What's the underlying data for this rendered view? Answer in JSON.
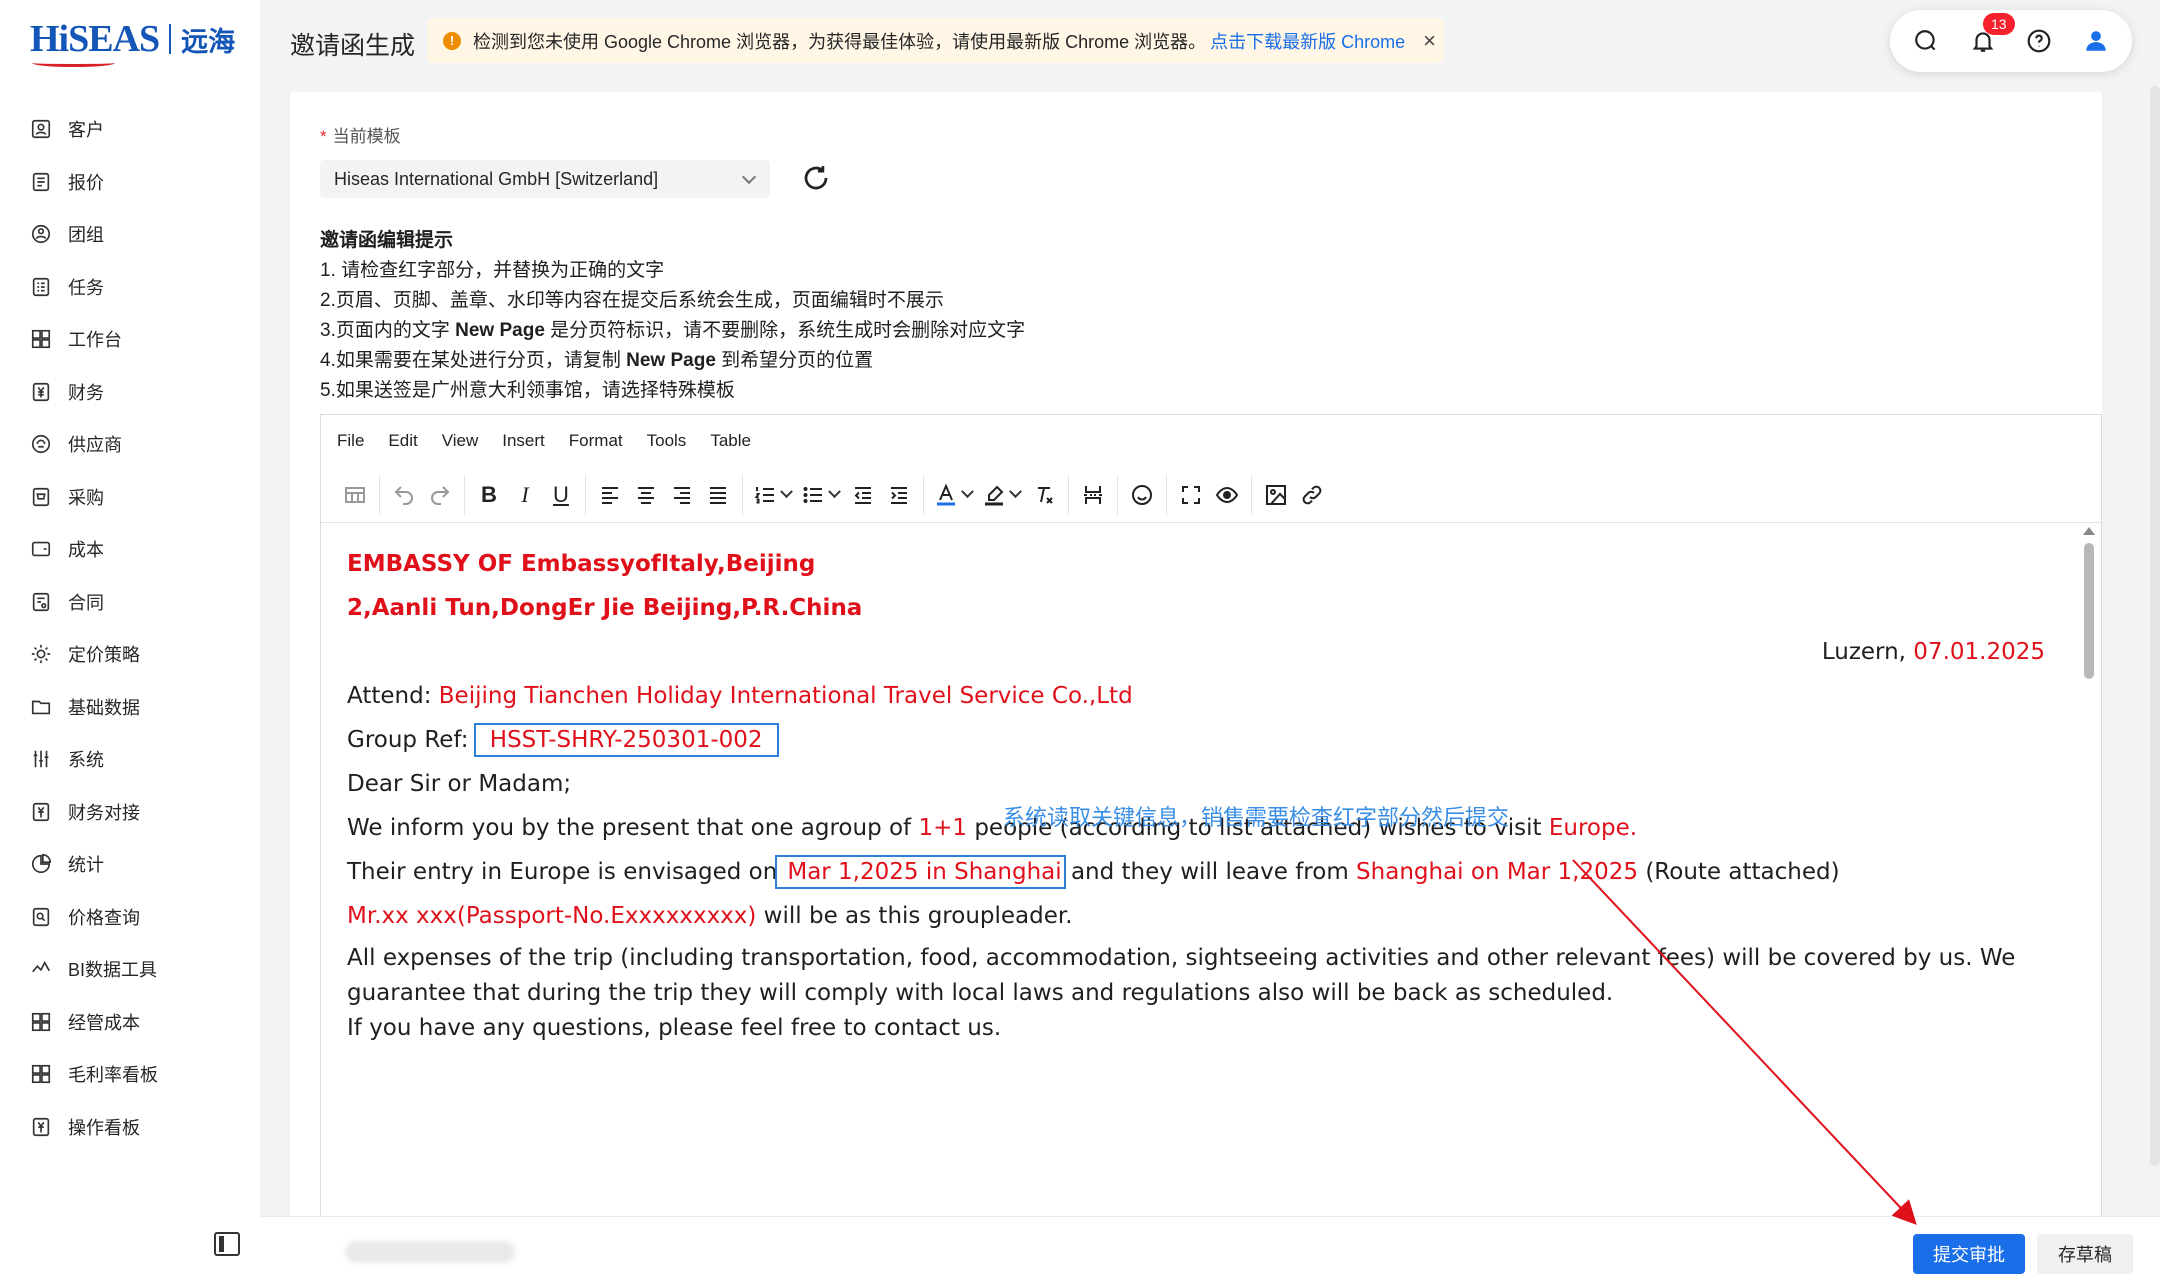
{
  "logo": {
    "main": "HiSEAS",
    "cn": "远海"
  },
  "sidebar": {
    "items": [
      {
        "label": "客户",
        "icon": "customer-icon"
      },
      {
        "label": "报价",
        "icon": "quote-icon"
      },
      {
        "label": "团组",
        "icon": "group-icon"
      },
      {
        "label": "任务",
        "icon": "task-icon"
      },
      {
        "label": "工作台",
        "icon": "workbench-icon"
      },
      {
        "label": "财务",
        "icon": "finance-icon"
      },
      {
        "label": "供应商",
        "icon": "supplier-icon"
      },
      {
        "label": "采购",
        "icon": "purchase-icon"
      },
      {
        "label": "成本",
        "icon": "cost-icon"
      },
      {
        "label": "合同",
        "icon": "contract-icon"
      },
      {
        "label": "定价策略",
        "icon": "pricing-icon"
      },
      {
        "label": "基础数据",
        "icon": "base-data-icon"
      },
      {
        "label": "系统",
        "icon": "system-icon"
      },
      {
        "label": "财务对接",
        "icon": "finance-link-icon"
      },
      {
        "label": "统计",
        "icon": "stats-icon"
      },
      {
        "label": "价格查询",
        "icon": "price-query-icon"
      },
      {
        "label": "BI数据工具",
        "icon": "bi-icon"
      },
      {
        "label": "经管成本",
        "icon": "mgmt-cost-icon"
      },
      {
        "label": "毛利率看板",
        "icon": "margin-board-icon"
      },
      {
        "label": "操作看板",
        "icon": "ops-board-icon"
      }
    ]
  },
  "header": {
    "title": "邀请函生成",
    "alert": {
      "text": "检测到您未使用 Google Chrome 浏览器，为获得最佳体验，请使用最新版 Chrome 浏览器。",
      "link": "点击下载最新版 Chrome"
    },
    "notification_count": "13"
  },
  "form": {
    "template_label": "当前模板",
    "template_value": "Hiseas International GmbH [Switzerland]"
  },
  "tips": {
    "title": "邀请函编辑提示",
    "line1": "1. 请检查红字部分，并替换为正确的文字",
    "line2": "2.页眉、页脚、盖章、水印等内容在提交后系统会生成，页面编辑时不展示",
    "line3_a": "3.页面内的文字 ",
    "line3_b": "New Page",
    "line3_c": " 是分页符标识，请不要删除，系统生成时会删除对应文字",
    "line4_a": "4.如果需要在某处进行分页，请复制 ",
    "line4_b": "New Page",
    "line4_c": " 到希望分页的位置",
    "line5": "5.如果送签是广州意大利领事馆，请选择特殊模板"
  },
  "editor": {
    "menu": [
      "File",
      "Edit",
      "View",
      "Insert",
      "Format",
      "Tools",
      "Table"
    ]
  },
  "document": {
    "embassy": "EMBASSY OF EmbassyofItaly,Beijing",
    "address": "2,Aanli Tun,DongEr Jie Beijing,P.R.China",
    "place": "Luzern, ",
    "date": "07.01.2025",
    "attend_label": "Attend: ",
    "attend_value": "Beijing Tianchen Holiday International Travel Service Co.,Ltd",
    "group_ref_label": "Group Ref:",
    "group_ref_value": "HSST-SHRY-250301-002",
    "salutation": "Dear Sir or Madam;",
    "inform_a": "We inform you by the present that one agroup of ",
    "inform_count": "1+1",
    "inform_b": " people (according to list attached) wishes to visit ",
    "inform_dest": "Europe.",
    "entry_a": "Their entry in Europe is envisaged on",
    "entry_date": "Mar 1,2025 in Shanghai",
    "entry_b": " and they will leave from ",
    "entry_leave": "Shanghai on Mar 1,2025",
    "entry_c": " (Route attached)",
    "leader_name": "Mr.xx xxx(Passport-No.Exxxxxxxxx)",
    "leader_b": "   will be as this groupleader.",
    "expenses": "All expenses of the trip (including transportation, food, accommodation, sightseeing activities and other relevant fees) will be covered by us. We guarantee that during the trip they will comply with local laws and regulations also will be back as scheduled.",
    "questions": "If you have any questions, please feel free to contact us."
  },
  "annotation": "系统读取关键信息，销售需要检查红字部分然后提交",
  "footer": {
    "submit": "提交审批",
    "draft": "存草稿"
  },
  "colors": {
    "primary": "#1a6ee8",
    "highlight_red": "#e0101a",
    "annotation_blue": "#3a8ee6",
    "alert_bg": "#fff6e6"
  }
}
